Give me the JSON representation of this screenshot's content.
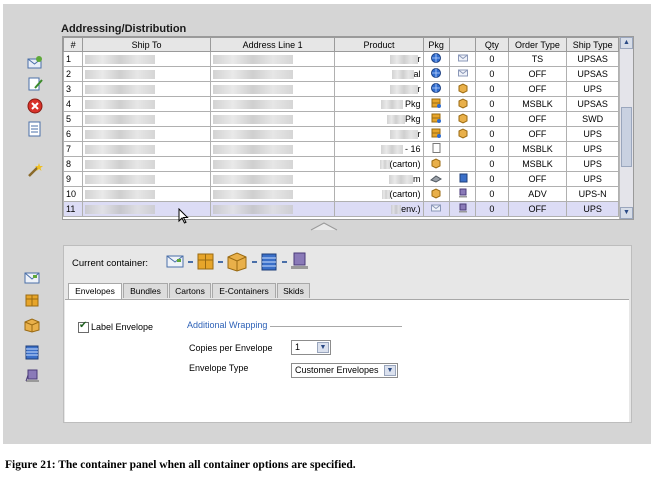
{
  "section_title": "Addressing/Distribution",
  "left_toolbar": {
    "icons": [
      "new-envelope-icon",
      "edit-icon",
      "delete-icon",
      "report-icon",
      "wand-icon"
    ]
  },
  "grid": {
    "columns": [
      "#",
      "Ship To",
      "Address Line 1",
      "Product",
      "Pkg",
      "",
      "Qty",
      "Order Type",
      "Ship Type"
    ],
    "rows": [
      {
        "num": "1",
        "product_tail": "r",
        "pkg": "globe",
        "cont": "envelope",
        "qty": "0",
        "order_type": "TS",
        "ship_type": "UPSAS"
      },
      {
        "num": "2",
        "product_tail": "al",
        "pkg": "globe",
        "cont": "envelope",
        "qty": "0",
        "order_type": "OFF",
        "ship_type": "UPSAS"
      },
      {
        "num": "3",
        "product_tail": "r",
        "pkg": "globe",
        "cont": "box",
        "qty": "0",
        "order_type": "OFF",
        "ship_type": "UPS"
      },
      {
        "num": "4",
        "product_tail": " Pkg",
        "pkg": "bundle",
        "cont": "box",
        "qty": "0",
        "order_type": "MSBLK",
        "ship_type": "UPSAS"
      },
      {
        "num": "5",
        "product_tail": "Pkg",
        "pkg": "bundle",
        "cont": "box",
        "qty": "0",
        "order_type": "OFF",
        "ship_type": "SWD"
      },
      {
        "num": "6",
        "product_tail": "r",
        "pkg": "bundle",
        "cont": "box",
        "qty": "0",
        "order_type": "OFF",
        "ship_type": "UPS"
      },
      {
        "num": "7",
        "product_tail": " - 16",
        "pkg": "doc",
        "cont": "",
        "qty": "0",
        "order_type": "MSBLK",
        "ship_type": "UPS"
      },
      {
        "num": "8",
        "product_tail": "(carton)",
        "pkg": "carton",
        "cont": "",
        "qty": "0",
        "order_type": "MSBLK",
        "ship_type": "UPS"
      },
      {
        "num": "9",
        "product_tail": "m",
        "pkg": "tray",
        "cont": "econt",
        "qty": "0",
        "order_type": "OFF",
        "ship_type": "UPS"
      },
      {
        "num": "10",
        "product_tail": "(carton)",
        "pkg": "carton",
        "cont": "skid",
        "qty": "0",
        "order_type": "ADV",
        "ship_type": "UPS-N"
      },
      {
        "num": "11",
        "product_tail": "env.)",
        "pkg": "envelope",
        "cont": "skid",
        "qty": "0",
        "order_type": "OFF",
        "ship_type": "UPS"
      }
    ]
  },
  "container_panel": {
    "current_container_label": "Current container:",
    "chain_icons": [
      "envelope-icon",
      "bundle-icon",
      "carton-icon",
      "e-container-icon",
      "skid-icon"
    ],
    "tabs": [
      "Envelopes",
      "Bundles",
      "Cartons",
      "E-Containers",
      "Skids"
    ],
    "active_tab": 0,
    "label_envelope_checked": true,
    "label_envelope_text": "Label Envelope",
    "group_title": "Additional Wrapping",
    "copies_label": "Copies per Envelope",
    "copies_value": "1",
    "envelope_type_label": "Envelope Type",
    "envelope_type_value": "Customer Envelopes"
  },
  "side_icons": [
    "envelope-icon",
    "bundle-icon",
    "carton-icon",
    "e-container-icon",
    "skid-icon"
  ],
  "caption": "Figure 21: The container panel when all container options are specified.",
  "colors": {
    "accent_blue": "#2e62b7",
    "selected_row": "#dcdcf5",
    "screen_bg": "#d5d5d5"
  }
}
